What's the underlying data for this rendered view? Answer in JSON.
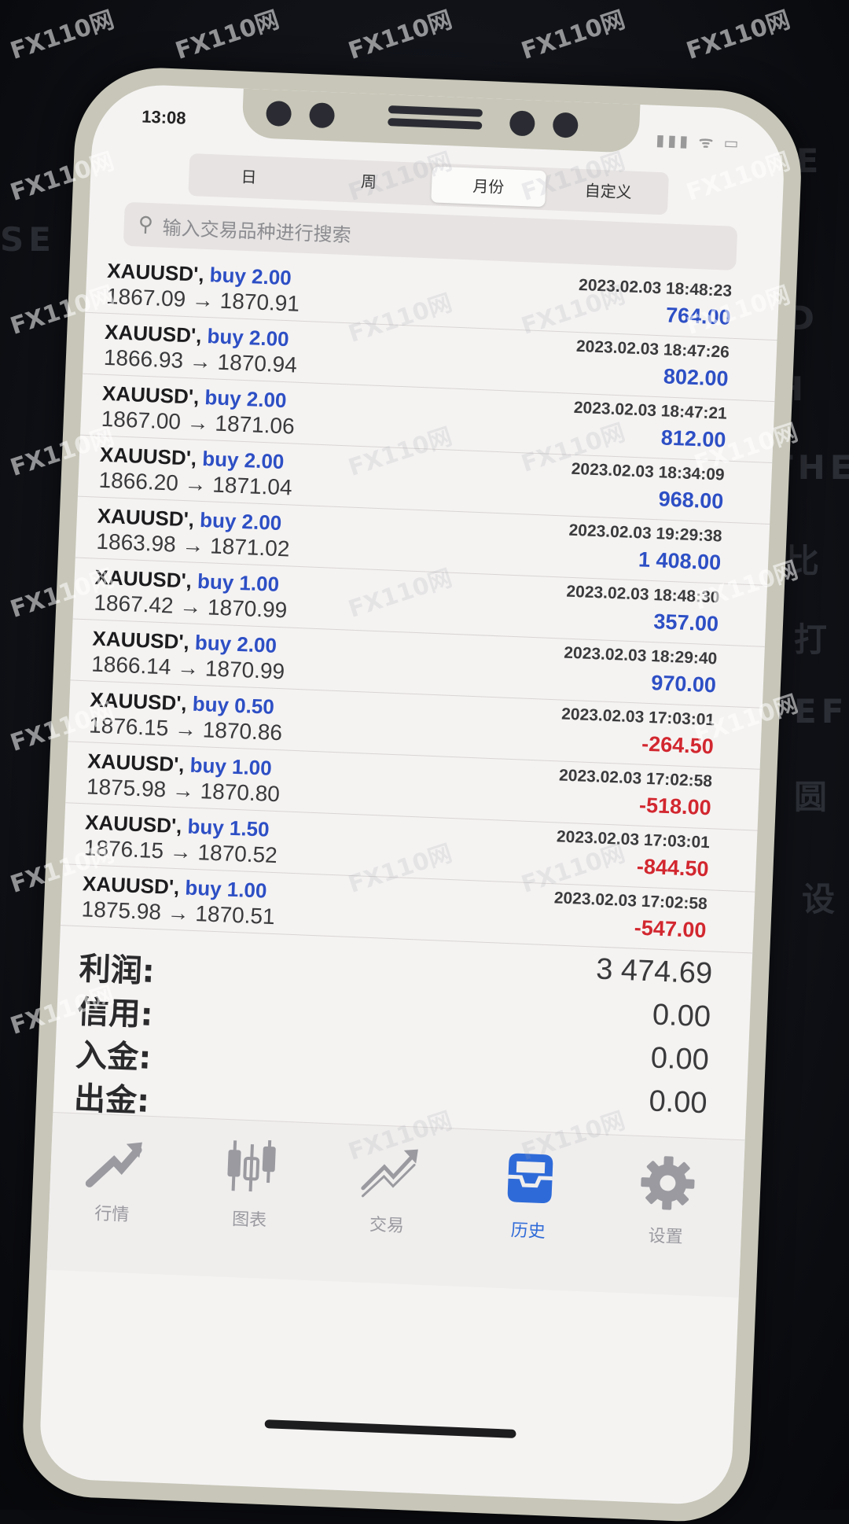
{
  "status_bar": {
    "time": "13:08",
    "icons": "▮▮▮ ᯤ ▭"
  },
  "period_tabs": [
    "日",
    "周",
    "月份",
    "自定义"
  ],
  "search": {
    "placeholder": "输入交易品种进行搜索"
  },
  "trades": [
    {
      "symbol": "XAUUSD'",
      "action": "buy 2.00",
      "price": "1867.09 → 1870.91",
      "datetime": "2023.02.03 18:48:23",
      "profit": "764.00",
      "sign": "positive"
    },
    {
      "symbol": "XAUUSD'",
      "action": "buy 2.00",
      "price": "1866.93 → 1870.94",
      "datetime": "2023.02.03 18:47:26",
      "profit": "802.00",
      "sign": "positive"
    },
    {
      "symbol": "XAUUSD'",
      "action": "buy 2.00",
      "price": "1867.00 → 1871.06",
      "datetime": "2023.02.03 18:47:21",
      "profit": "812.00",
      "sign": "positive"
    },
    {
      "symbol": "XAUUSD'",
      "action": "buy 2.00",
      "price": "1866.20 → 1871.04",
      "datetime": "2023.02.03 18:34:09",
      "profit": "968.00",
      "sign": "positive"
    },
    {
      "symbol": "XAUUSD'",
      "action": "buy 2.00",
      "price": "1863.98 → 1871.02",
      "datetime": "2023.02.03 19:29:38",
      "profit": "1 408.00",
      "sign": "positive"
    },
    {
      "symbol": "XAUUSD'",
      "action": "buy 1.00",
      "price": "1867.42 → 1870.99",
      "datetime": "2023.02.03 18:48:30",
      "profit": "357.00",
      "sign": "positive"
    },
    {
      "symbol": "XAUUSD'",
      "action": "buy 2.00",
      "price": "1866.14 → 1870.99",
      "datetime": "2023.02.03 18:29:40",
      "profit": "970.00",
      "sign": "positive"
    },
    {
      "symbol": "XAUUSD'",
      "action": "buy 0.50",
      "price": "1876.15 → 1870.86",
      "datetime": "2023.02.03 17:03:01",
      "profit": "-264.50",
      "sign": "negative"
    },
    {
      "symbol": "XAUUSD'",
      "action": "buy 1.00",
      "price": "1875.98 → 1870.80",
      "datetime": "2023.02.03 17:02:58",
      "profit": "-518.00",
      "sign": "negative"
    },
    {
      "symbol": "XAUUSD'",
      "action": "buy 1.50",
      "price": "1876.15 → 1870.52",
      "datetime": "2023.02.03 17:03:01",
      "profit": "-844.50",
      "sign": "negative"
    },
    {
      "symbol": "XAUUSD'",
      "action": "buy 1.00",
      "price": "1875.98 → 1870.51",
      "datetime": "2023.02.03 17:02:58",
      "profit": "-547.00",
      "sign": "negative"
    }
  ],
  "summary": [
    {
      "label": "利润:",
      "value": "3 474.69"
    },
    {
      "label": "信用:",
      "value": "0.00"
    },
    {
      "label": "入金:",
      "value": "0.00"
    },
    {
      "label": "出金:",
      "value": "0.00"
    }
  ],
  "tabbar": [
    {
      "label": "行情",
      "icon": "quotes-icon"
    },
    {
      "label": "图表",
      "icon": "chart-icon"
    },
    {
      "label": "交易",
      "icon": "trade-icon"
    },
    {
      "label": "历史",
      "icon": "history-icon",
      "active": true
    },
    {
      "label": "设置",
      "icon": "settings-icon"
    }
  ],
  "watermark": "FX110网",
  "colors": {
    "positive": "#2d4fc5",
    "negative": "#d2272f",
    "active_tab": "#2f6bd8"
  }
}
